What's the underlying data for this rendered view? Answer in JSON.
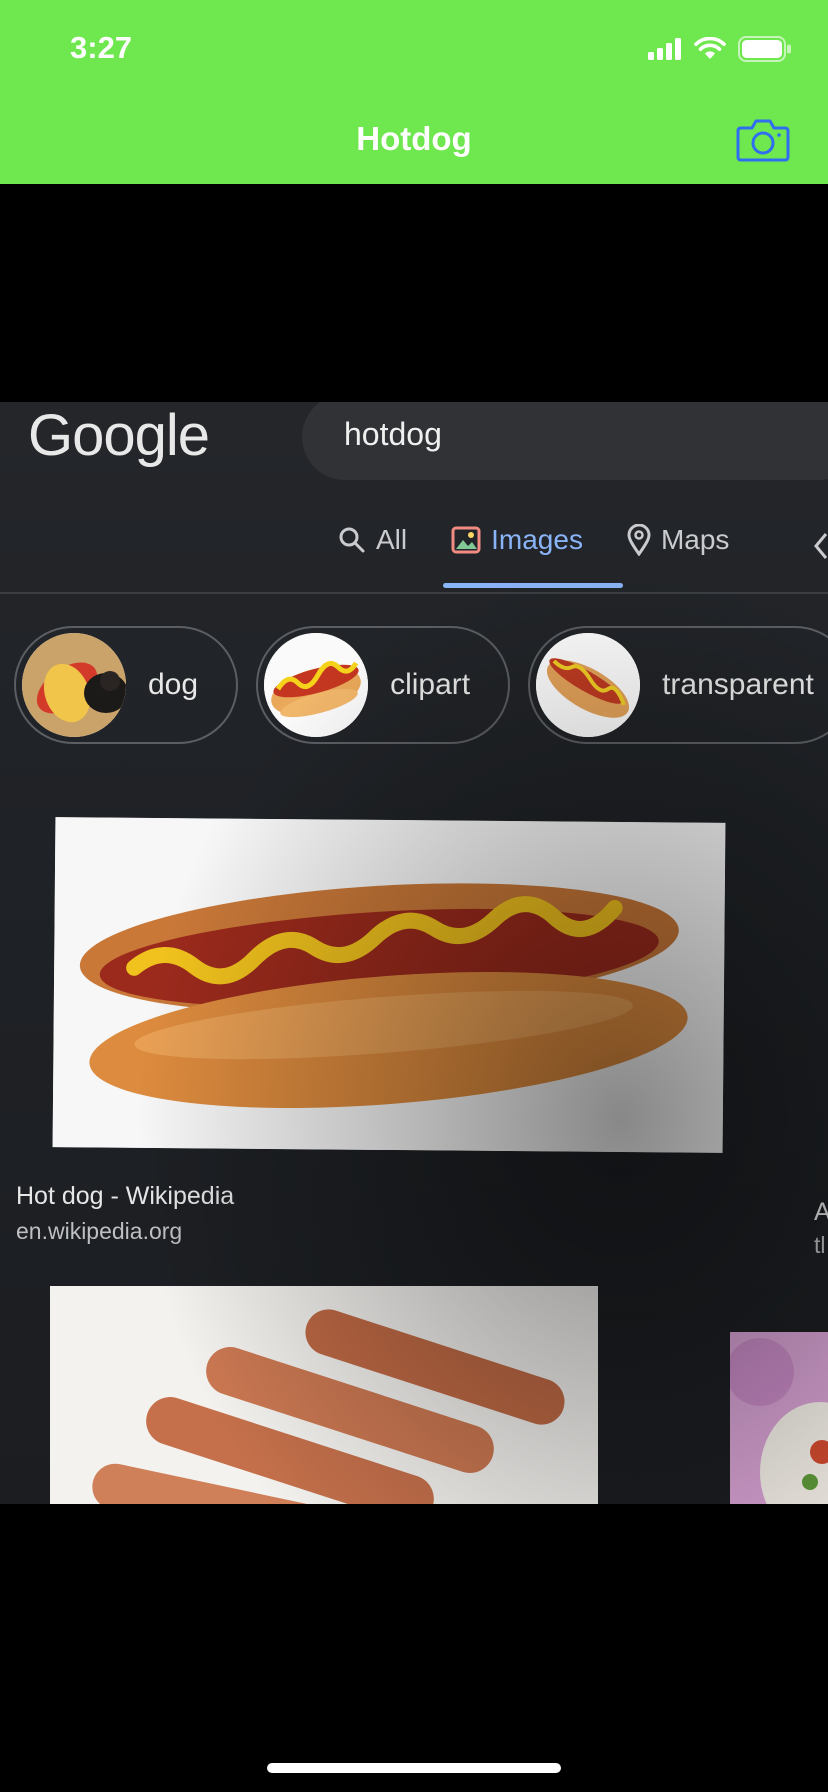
{
  "status_bar": {
    "time": "3:27",
    "signal": "signal-icon",
    "wifi": "wifi-icon",
    "battery": "battery-icon"
  },
  "nav": {
    "title": "Hotdog",
    "camera_icon": "camera-icon"
  },
  "colors": {
    "nav_background": "#6fe74e",
    "camera_blue": "#2f6ef0",
    "link_blue": "#8ab4f8"
  },
  "photo": {
    "logo": "Google",
    "search_query": "hotdog",
    "tabs": [
      {
        "label": "All",
        "icon": "search-icon"
      },
      {
        "label": "Images",
        "icon": "image-icon"
      },
      {
        "label": "Maps",
        "icon": "map-pin-icon"
      }
    ],
    "chips": [
      {
        "label": "dog"
      },
      {
        "label": "clipart"
      },
      {
        "label": "transparent"
      }
    ],
    "results": [
      {
        "title": "Hot dog - Wikipedia",
        "domain": "en.wikipedia.org"
      }
    ],
    "right_peek": {
      "title_fragment": "A",
      "domain_fragment": "tl"
    }
  }
}
